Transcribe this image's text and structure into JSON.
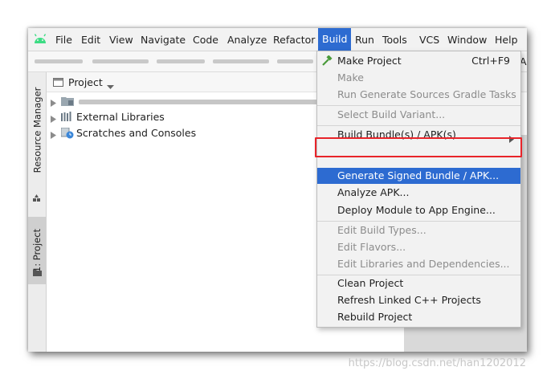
{
  "menubar": {
    "items": [
      {
        "label": "File"
      },
      {
        "label": "Edit"
      },
      {
        "label": "View"
      },
      {
        "label": "Navigate"
      },
      {
        "label": "Code"
      },
      {
        "label": "Analyze"
      },
      {
        "label": "Refactor"
      },
      {
        "label": "Build"
      },
      {
        "label": "Run"
      },
      {
        "label": "Tools"
      },
      {
        "label": "VCS"
      },
      {
        "label": "Window"
      },
      {
        "label": "Help"
      }
    ],
    "active_item": "Build"
  },
  "navbar": {
    "right_letter": "A"
  },
  "leftstrip": {
    "tabs": [
      {
        "label": "Resource Manager"
      },
      {
        "label": "1: Project"
      }
    ]
  },
  "project_panel": {
    "title": "Project",
    "tree": [
      {
        "label": ""
      },
      {
        "label": "External Libraries"
      },
      {
        "label": "Scratches and Consoles"
      }
    ]
  },
  "build_menu": {
    "items": [
      {
        "label": "Make Project",
        "shortcut": "Ctrl+F9",
        "enabled": true
      },
      {
        "label": "Make",
        "enabled": false
      },
      {
        "label": "Run Generate Sources Gradle Tasks",
        "enabled": false
      },
      {
        "label": "Select Build Variant...",
        "enabled": false
      },
      {
        "label": "Build Bundle(s) / APK(s)",
        "enabled": true,
        "submenu": true
      },
      {
        "label": "Generate Signed Bundle / APK...",
        "enabled": true,
        "highlighted": true
      },
      {
        "label": "Analyze APK...",
        "enabled": true
      },
      {
        "label": "Deploy Module to App Engine...",
        "enabled": true
      },
      {
        "label": "Edit Build Types...",
        "enabled": false
      },
      {
        "label": "Edit Flavors...",
        "enabled": false
      },
      {
        "label": "Edit Libraries and Dependencies...",
        "enabled": false
      },
      {
        "label": "Clean Project",
        "enabled": true
      },
      {
        "label": "Refresh Linked C++ Projects",
        "enabled": true
      },
      {
        "label": "Rebuild Project",
        "enabled": true
      }
    ]
  },
  "colors": {
    "accent": "#2d6bd1",
    "annotation_red": "#e8242a"
  },
  "watermark": "https://blog.csdn.net/han1202012"
}
